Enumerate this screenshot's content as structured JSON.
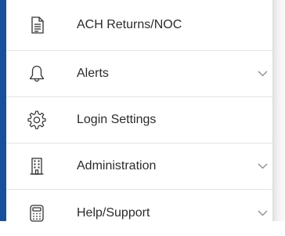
{
  "menu": {
    "items": [
      {
        "label": "ACH Returns/NOC",
        "icon": "document-icon",
        "expandable": false
      },
      {
        "label": "Alerts",
        "icon": "bell-icon",
        "expandable": true
      },
      {
        "label": "Login Settings",
        "icon": "gear-icon",
        "expandable": false
      },
      {
        "label": "Administration",
        "icon": "building-icon",
        "expandable": true
      },
      {
        "label": "Help/Support",
        "icon": "calculator-icon",
        "expandable": true
      }
    ]
  },
  "colors": {
    "accent": "#1a4f9c",
    "text": "#2b2b2b",
    "icon": "#333333",
    "divider": "#e3e3e3",
    "chevron": "#8a8a8a"
  }
}
